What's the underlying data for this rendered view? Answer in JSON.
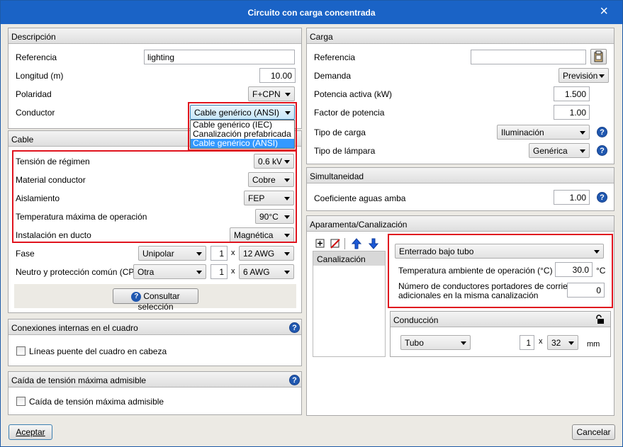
{
  "window": {
    "title": "Circuito con carga concentrada",
    "close_icon": "×"
  },
  "descripcion": {
    "header": "Descripción",
    "referencia_label": "Referencia",
    "referencia_value": "lighting",
    "longitud_label": "Longitud (m)",
    "longitud_value": "10.00",
    "polaridad_label": "Polaridad",
    "polaridad_value": "F+CPN",
    "conductor_label": "Conductor",
    "conductor_value": "Cable genérico (ANSI)",
    "conductor_options": [
      "Cable genérico (IEC)",
      "Canalización prefabricada",
      "Cable genérico (ANSI)"
    ]
  },
  "cable": {
    "header": "Cable",
    "tension_label": "Tensión de régimen",
    "tension_value": "0.6 kV",
    "material_label": "Material conductor",
    "material_value": "Cobre",
    "aislamiento_label": "Aislamiento",
    "aislamiento_value": "FEP",
    "temperatura_label": "Temperatura máxima de operación",
    "temperatura_value": "90°C",
    "instalacion_label": "Instalación en ducto",
    "instalacion_value": "Magnética",
    "fase_label": "Fase",
    "fase_type": "Unipolar",
    "fase_count": "1",
    "fase_size": "12 AWG",
    "neutro_label": "Neutro y protección común (CPN)",
    "neutro_type": "Otra",
    "neutro_count": "1",
    "neutro_size": "6 AWG",
    "times": "x",
    "consultar_label": "Consultar selección"
  },
  "conexiones": {
    "header": "Conexiones internas en el cuadro",
    "checkbox_label": "Líneas puente del cuadro en cabeza"
  },
  "caida": {
    "header": "Caída de tensión máxima admisible",
    "checkbox_label": "Caída de tensión máxima admisible"
  },
  "carga": {
    "header": "Carga",
    "referencia_label": "Referencia",
    "referencia_value": "",
    "demanda_label": "Demanda",
    "demanda_value": "Previsión",
    "potencia_label": "Potencia activa (kW)",
    "potencia_value": "1.500",
    "factor_label": "Factor de potencia",
    "factor_value": "1.00",
    "tipo_carga_label": "Tipo de carga",
    "tipo_carga_value": "Iluminación",
    "tipo_lampara_label": "Tipo de lámpara",
    "tipo_lampara_value": "Genérica"
  },
  "simultaneidad": {
    "header": "Simultaneidad",
    "coef_label": "Coeficiente aguas amba",
    "coef_value": "1.00"
  },
  "aparamenta": {
    "header": "Aparamenta/Canalización",
    "list_item": "Canalización",
    "instalacion_value": "Enterrado bajo tubo",
    "temp_label": "Temperatura ambiente de operación (°C)",
    "temp_value": "30.0",
    "temp_unit": "°C",
    "num_label_line1": "Número de conductores portadores de corriente",
    "num_label_line2": "adicionales en la misma canalización",
    "num_value": "0",
    "conduccion_header": "Conducción",
    "conduccion_type": "Tubo",
    "conduccion_count": "1",
    "conduccion_size": "32",
    "conduccion_unit": "mm"
  },
  "footer": {
    "aceptar": "Aceptar",
    "cancelar": "Cancelar"
  },
  "help_icon": "?"
}
